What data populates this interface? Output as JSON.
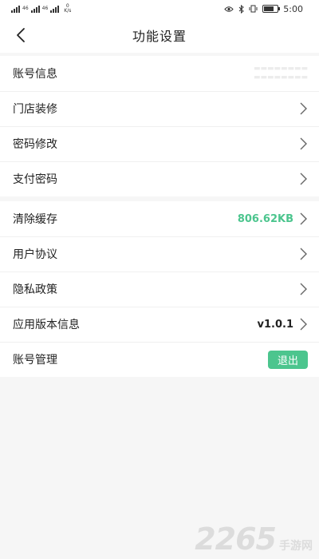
{
  "status_bar": {
    "signal1": "46",
    "signal2": "46",
    "net_speed_value": "0",
    "net_speed_unit": "K/s",
    "time": "5:00"
  },
  "header": {
    "title": "功能设置",
    "back_icon": "chevron-left-icon"
  },
  "account_section": {
    "items": [
      {
        "label": "账号信息"
      },
      {
        "label": "门店装修"
      },
      {
        "label": "密码修改"
      },
      {
        "label": "支付密码"
      }
    ]
  },
  "misc_section": {
    "items": [
      {
        "label": "清除缓存",
        "value": "806.62KB"
      },
      {
        "label": "用户协议"
      },
      {
        "label": "隐私政策"
      },
      {
        "label": "应用版本信息",
        "value": "v1.0.1"
      },
      {
        "label": "账号管理",
        "button": "退出"
      }
    ]
  },
  "watermark": {
    "number": "2265",
    "text": "手游网"
  },
  "colors": {
    "accent": "#4cc58e",
    "background": "#f6f6f6"
  }
}
